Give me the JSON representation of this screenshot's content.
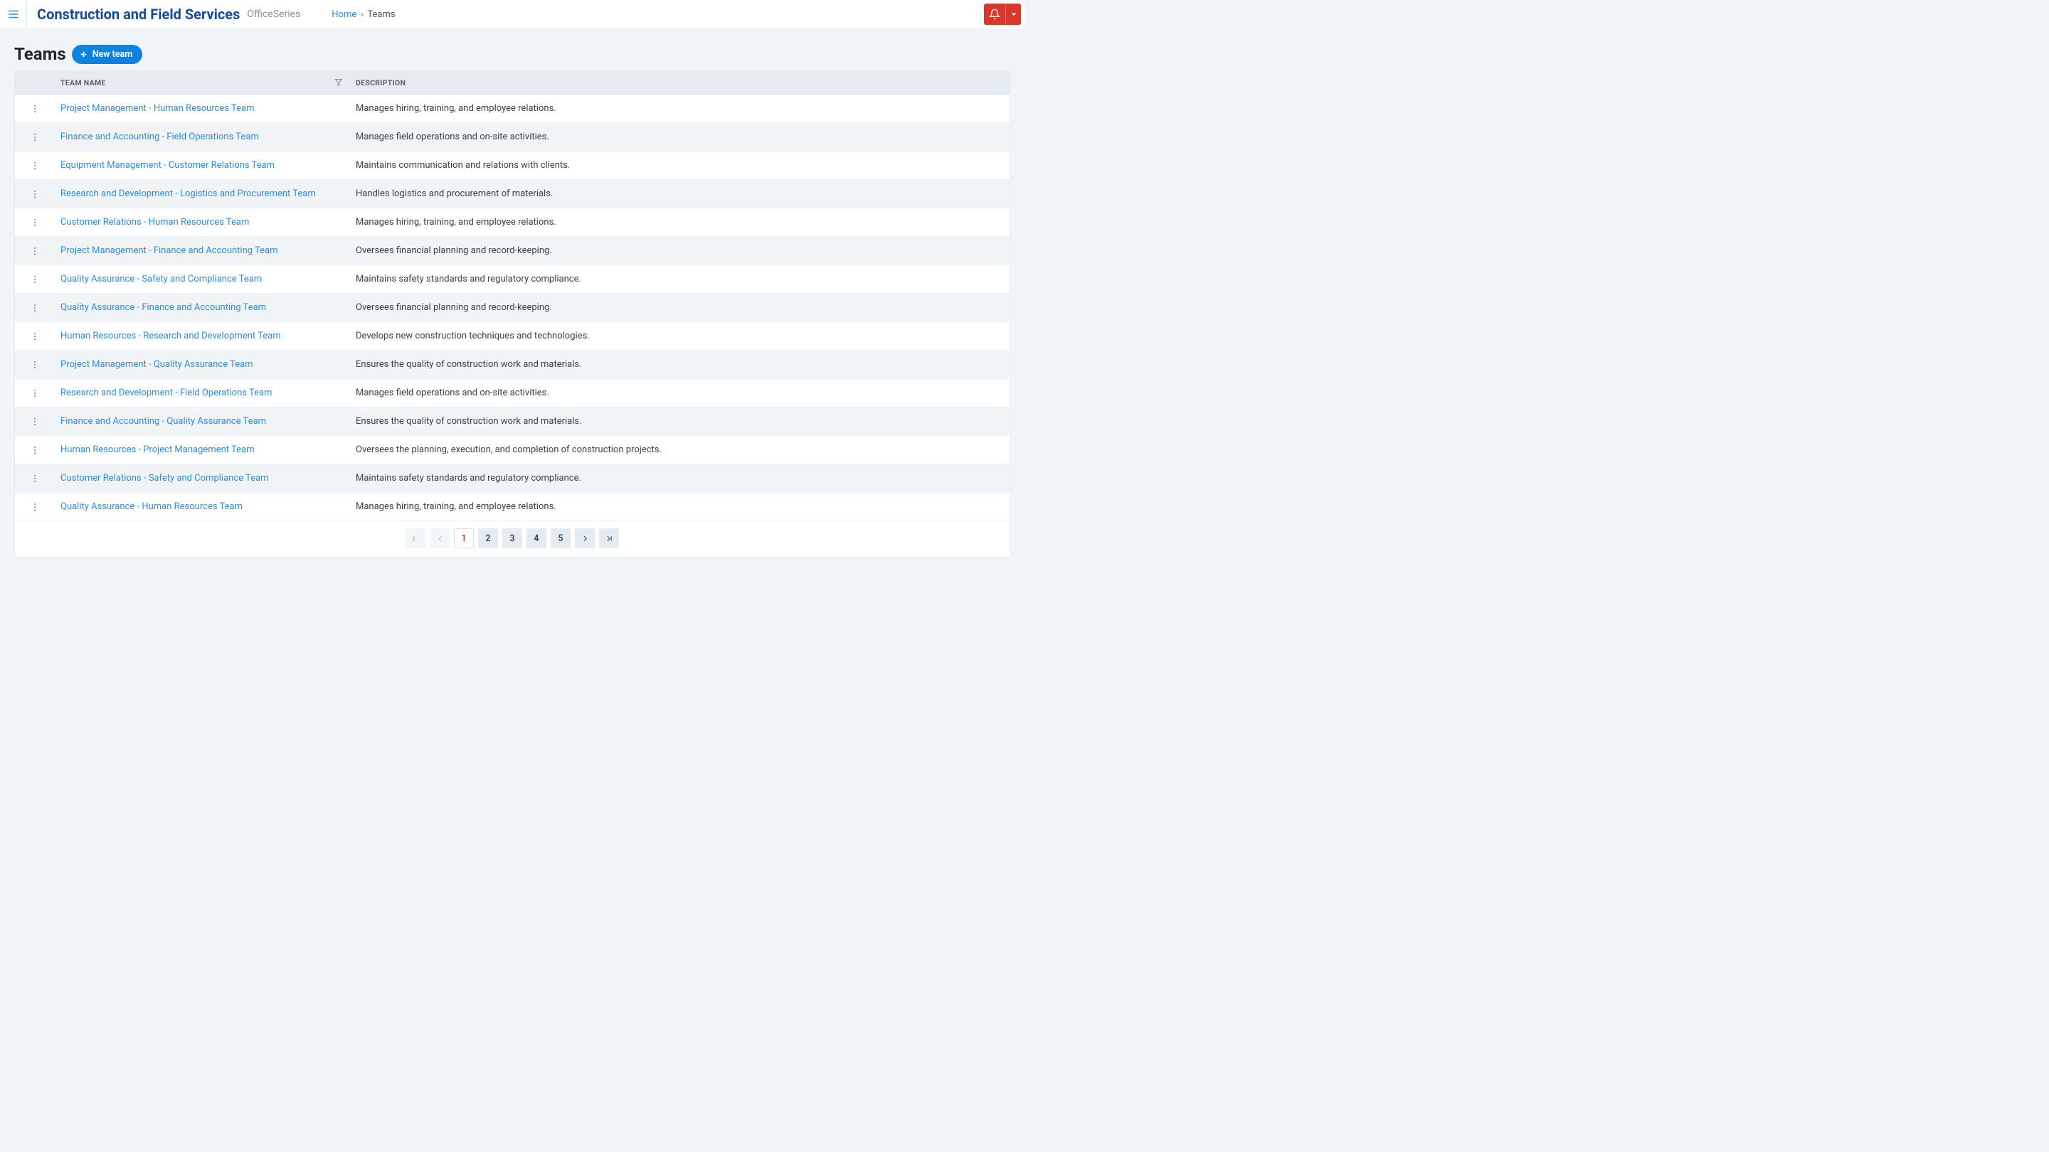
{
  "app": {
    "title": "Construction and Field Services",
    "subtitle": "OfficeSeries"
  },
  "breadcrumb": {
    "home": "Home",
    "current": "Teams"
  },
  "page": {
    "title": "Teams",
    "new_button": "New team"
  },
  "table": {
    "headers": {
      "name": "Team Name",
      "description": "Description"
    },
    "rows": [
      {
        "name": "Project Management - Human Resources Team",
        "description": "Manages hiring, training, and employee relations."
      },
      {
        "name": "Finance and Accounting - Field Operations Team",
        "description": "Manages field operations and on-site activities."
      },
      {
        "name": "Equipment Management - Customer Relations Team",
        "description": "Maintains communication and relations with clients."
      },
      {
        "name": "Research and Development - Logistics and Procurement Team",
        "description": "Handles logistics and procurement of materials."
      },
      {
        "name": "Customer Relations - Human Resources Team",
        "description": "Manages hiring, training, and employee relations."
      },
      {
        "name": "Project Management - Finance and Accounting Team",
        "description": "Oversees financial planning and record-keeping."
      },
      {
        "name": "Quality Assurance - Safety and Compliance Team",
        "description": "Maintains safety standards and regulatory compliance."
      },
      {
        "name": "Quality Assurance - Finance and Accounting Team",
        "description": "Oversees financial planning and record-keeping."
      },
      {
        "name": "Human Resources - Research and Development Team",
        "description": "Develops new construction techniques and technologies."
      },
      {
        "name": "Project Management - Quality Assurance Team",
        "description": "Ensures the quality of construction work and materials."
      },
      {
        "name": "Research and Development - Field Operations Team",
        "description": "Manages field operations and on-site activities."
      },
      {
        "name": "Finance and Accounting - Quality Assurance Team",
        "description": "Ensures the quality of construction work and materials."
      },
      {
        "name": "Human Resources - Project Management Team",
        "description": "Oversees the planning, execution, and completion of construction projects."
      },
      {
        "name": "Customer Relations - Safety and Compliance Team",
        "description": "Maintains safety standards and regulatory compliance."
      },
      {
        "name": "Quality Assurance - Human Resources Team",
        "description": "Manages hiring, training, and employee relations."
      }
    ]
  },
  "pagination": {
    "pages": [
      "1",
      "2",
      "3",
      "4",
      "5"
    ],
    "current": "1"
  }
}
